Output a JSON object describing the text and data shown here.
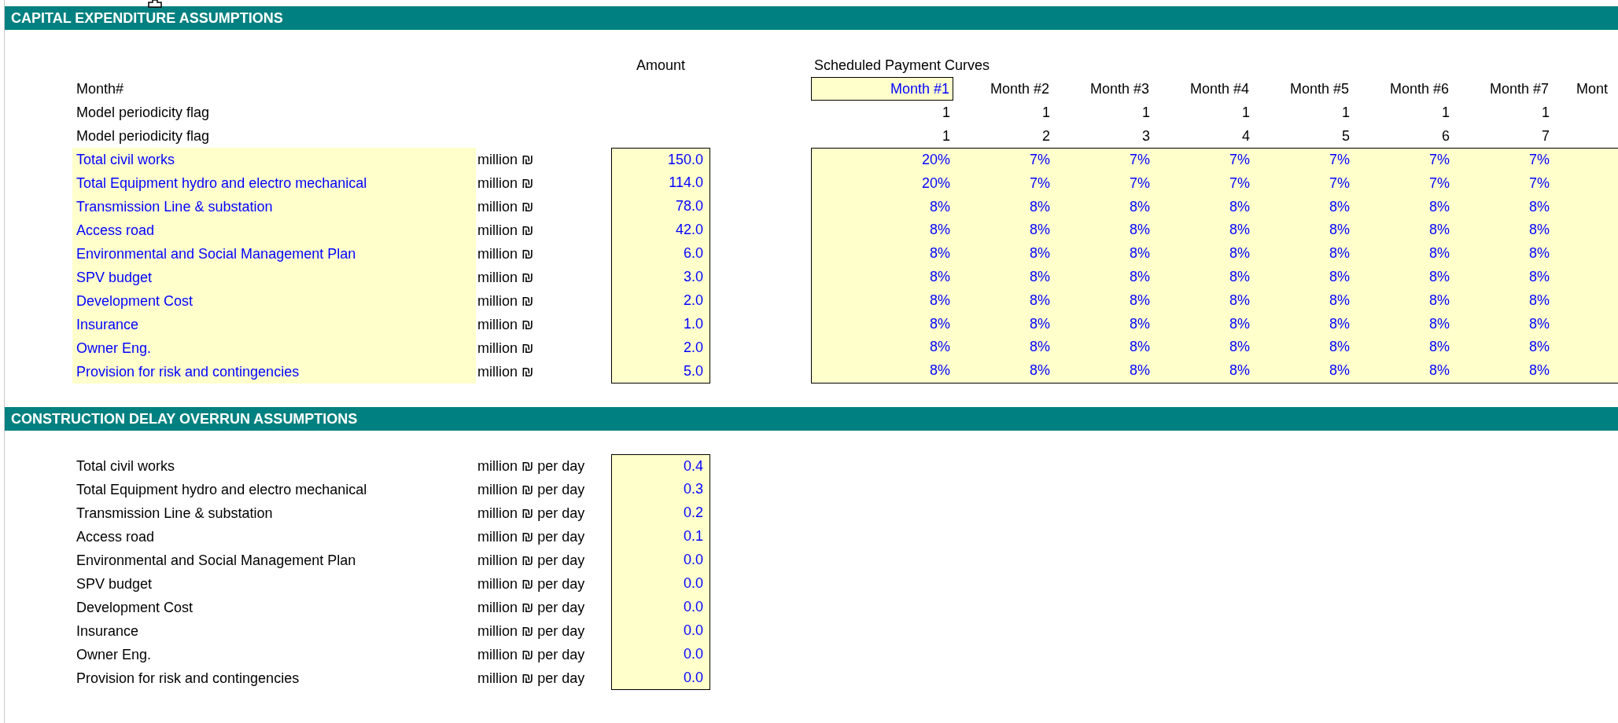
{
  "capex": {
    "title": "CAPITAL EXPENDITURE ASSUMPTIONS",
    "amount_header": "Amount",
    "curves_header": "Scheduled Payment Curves",
    "month_label": "Month#",
    "months": [
      {
        "label": "Month #1",
        "selected": true
      },
      {
        "label": "Month #2",
        "selected": false
      },
      {
        "label": "Month #3",
        "selected": false
      },
      {
        "label": "Month #4",
        "selected": false
      },
      {
        "label": "Month #5",
        "selected": false
      },
      {
        "label": "Month #6",
        "selected": false
      },
      {
        "label": "Month #7",
        "selected": false
      },
      {
        "label": "Mont",
        "selected": false
      }
    ],
    "flag_rows": [
      {
        "label": "Model periodicity flag",
        "values": [
          "1",
          "1",
          "1",
          "1",
          "1",
          "1",
          "1"
        ]
      },
      {
        "label": "Model periodicity flag",
        "values": [
          "1",
          "2",
          "3",
          "4",
          "5",
          "6",
          "7"
        ]
      }
    ],
    "items": [
      {
        "label": "Total civil works",
        "unit": "million ₪",
        "amount": "150.0",
        "curve": [
          "20%",
          "7%",
          "7%",
          "7%",
          "7%",
          "7%",
          "7%"
        ]
      },
      {
        "label": "Total Equipment hydro and electro mechanical",
        "unit": "million ₪",
        "amount": "114.0",
        "curve": [
          "20%",
          "7%",
          "7%",
          "7%",
          "7%",
          "7%",
          "7%"
        ]
      },
      {
        "label": "Transmission Line & substation",
        "unit": "million ₪",
        "amount": "78.0",
        "curve": [
          "8%",
          "8%",
          "8%",
          "8%",
          "8%",
          "8%",
          "8%"
        ]
      },
      {
        "label": "Access road",
        "unit": "million ₪",
        "amount": "42.0",
        "curve": [
          "8%",
          "8%",
          "8%",
          "8%",
          "8%",
          "8%",
          "8%"
        ]
      },
      {
        "label": "Environmental and Social Management Plan",
        "unit": "million ₪",
        "amount": "6.0",
        "curve": [
          "8%",
          "8%",
          "8%",
          "8%",
          "8%",
          "8%",
          "8%"
        ]
      },
      {
        "label": "SPV budget",
        "unit": "million ₪",
        "amount": "3.0",
        "curve": [
          "8%",
          "8%",
          "8%",
          "8%",
          "8%",
          "8%",
          "8%"
        ]
      },
      {
        "label": "Development Cost",
        "unit": "million ₪",
        "amount": "2.0",
        "curve": [
          "8%",
          "8%",
          "8%",
          "8%",
          "8%",
          "8%",
          "8%"
        ]
      },
      {
        "label": "Insurance",
        "unit": "million ₪",
        "amount": "1.0",
        "curve": [
          "8%",
          "8%",
          "8%",
          "8%",
          "8%",
          "8%",
          "8%"
        ]
      },
      {
        "label": "Owner Eng.",
        "unit": "million ₪",
        "amount": "2.0",
        "curve": [
          "8%",
          "8%",
          "8%",
          "8%",
          "8%",
          "8%",
          "8%"
        ]
      },
      {
        "label": "Provision for risk and contingencies",
        "unit": "million ₪",
        "amount": "5.0",
        "curve": [
          "8%",
          "8%",
          "8%",
          "8%",
          "8%",
          "8%",
          "8%"
        ]
      }
    ]
  },
  "delay": {
    "title": "CONSTRUCTION DELAY OVERRUN ASSUMPTIONS",
    "items": [
      {
        "label": "Total civil works",
        "unit": "million ₪ per day",
        "value": "0.4"
      },
      {
        "label": "Total Equipment hydro and electro mechanical",
        "unit": "million ₪ per day",
        "value": "0.3"
      },
      {
        "label": "Transmission Line & substation",
        "unit": "million ₪ per day",
        "value": "0.2"
      },
      {
        "label": "Access road",
        "unit": "million ₪ per day",
        "value": "0.1"
      },
      {
        "label": "Environmental and Social Management Plan",
        "unit": "million ₪ per day",
        "value": "0.0"
      },
      {
        "label": "SPV budget",
        "unit": "million ₪ per day",
        "value": "0.0"
      },
      {
        "label": "Development Cost",
        "unit": "million ₪ per day",
        "value": "0.0"
      },
      {
        "label": "Insurance",
        "unit": "million ₪ per day",
        "value": "0.0"
      },
      {
        "label": "Owner Eng.",
        "unit": "million ₪ per day",
        "value": "0.0"
      },
      {
        "label": "Provision for risk and contingencies",
        "unit": "million ₪ per day",
        "value": "0.0"
      }
    ]
  }
}
